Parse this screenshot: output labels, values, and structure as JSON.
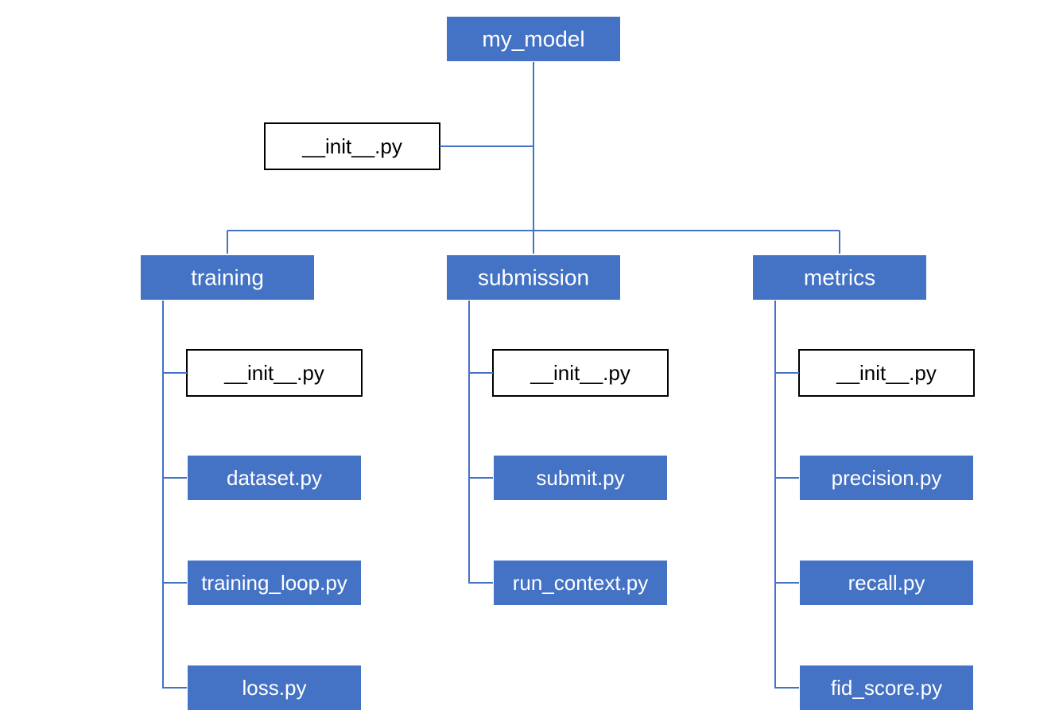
{
  "root": {
    "label": "my_model",
    "init": "__init__.py",
    "children": [
      {
        "label": "training",
        "init": "__init__.py",
        "files": [
          "dataset.py",
          "training_loop.py",
          "loss.py"
        ]
      },
      {
        "label": "submission",
        "init": "__init__.py",
        "files": [
          "submit.py",
          "run_context.py"
        ]
      },
      {
        "label": "metrics",
        "init": "__init__.py",
        "files": [
          "precision.py",
          "recall.py",
          "fid_score.py"
        ]
      }
    ]
  },
  "colors": {
    "folder_fill": "#4472c4",
    "folder_stroke": "#ffffff",
    "init_stroke": "#000000",
    "connector": "#4472c4"
  }
}
